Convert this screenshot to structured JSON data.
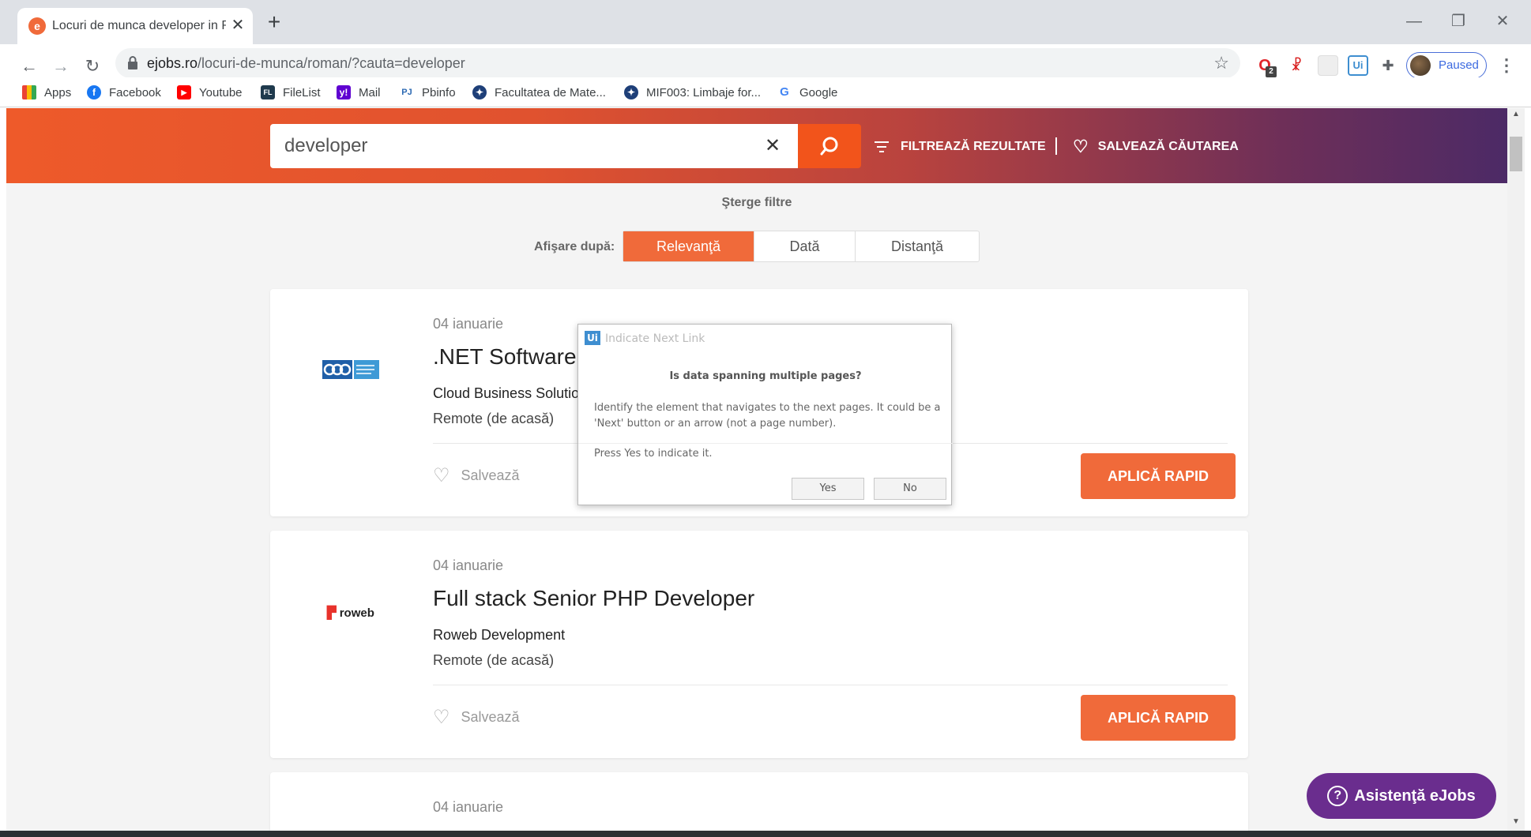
{
  "browser": {
    "tab_title": "Locuri de munca developer in Ro",
    "tab_favicon_letter": "e",
    "url_host": "ejobs.ro",
    "url_path": "/locuri-de-munca/roman/?cauta=developer",
    "profile_label": "Paused",
    "extensions": [
      {
        "name": "opera-extension-icon",
        "glyph": "O",
        "badge": "2"
      },
      {
        "name": "red-extension-icon",
        "glyph": "☧"
      },
      {
        "name": "blank-extension-icon",
        "glyph": ""
      },
      {
        "name": "uipath-extension-icon",
        "glyph": "Ui"
      },
      {
        "name": "puzzle-extensions-icon",
        "glyph": "✚"
      }
    ],
    "bookmarks": [
      {
        "label": "Apps",
        "icon": "apps-grid-icon"
      },
      {
        "label": "Facebook",
        "icon": "facebook-icon",
        "color": "#1877f2"
      },
      {
        "label": "Youtube",
        "icon": "youtube-icon",
        "color": "#ff0000"
      },
      {
        "label": "FileList",
        "icon": "filelist-icon",
        "color": "#1f3a4d"
      },
      {
        "label": "Mail",
        "icon": "yahoo-mail-icon",
        "color": "#5f01d1"
      },
      {
        "label": "Pbinfo",
        "icon": "pbinfo-icon",
        "color": "#2d6ab3"
      },
      {
        "label": "Facultatea de Mate...",
        "icon": "university-icon",
        "color": "#1e3f78"
      },
      {
        "label": "MIF003: Limbaje for...",
        "icon": "university-icon",
        "color": "#1e3f78"
      },
      {
        "label": "Google",
        "icon": "google-icon",
        "color": "#4285f4"
      }
    ]
  },
  "hero": {
    "search_value": "developer",
    "filter_label": "FILTREAZĂ REZULTATE",
    "save_search_label": "SALVEAZĂ CĂUTAREA"
  },
  "filters": {
    "clear_label": "Şterge filtre",
    "sort_label": "Afişare după:",
    "sort_options": [
      "Relevanţă",
      "Dată",
      "Distanţă"
    ],
    "sort_selected": "Relevanţă"
  },
  "jobs": [
    {
      "date": "04 ianuarie",
      "title": ".NET Software Developer",
      "company": "Cloud Business Solutions",
      "location": "Remote (de acasă)",
      "save_label": "Salvează",
      "apply_label": "APLICĂ RAPID",
      "logo": "cbs"
    },
    {
      "date": "04 ianuarie",
      "title": "Full stack Senior PHP Developer",
      "company": "Roweb Development",
      "location": "Remote (de acasă)",
      "save_label": "Salvează",
      "apply_label": "APLICĂ RAPID",
      "logo_text": "roweb"
    },
    {
      "date": "04 ianuarie"
    }
  ],
  "help_label": "Asistenţă eJobs",
  "dialog": {
    "logo": "Ui",
    "title": "Indicate Next Link",
    "heading": "Is data spanning multiple pages?",
    "body": "Identify the element that navigates to the next pages. It could be a 'Next' button or an arrow (not a page number).",
    "hint": "Press Yes to indicate it.",
    "yes_label": "Yes",
    "no_label": "No"
  },
  "colors": {
    "brand_orange": "#f06a3a",
    "hero_purple": "#4c2a66",
    "help_purple": "#6a2d8e"
  }
}
